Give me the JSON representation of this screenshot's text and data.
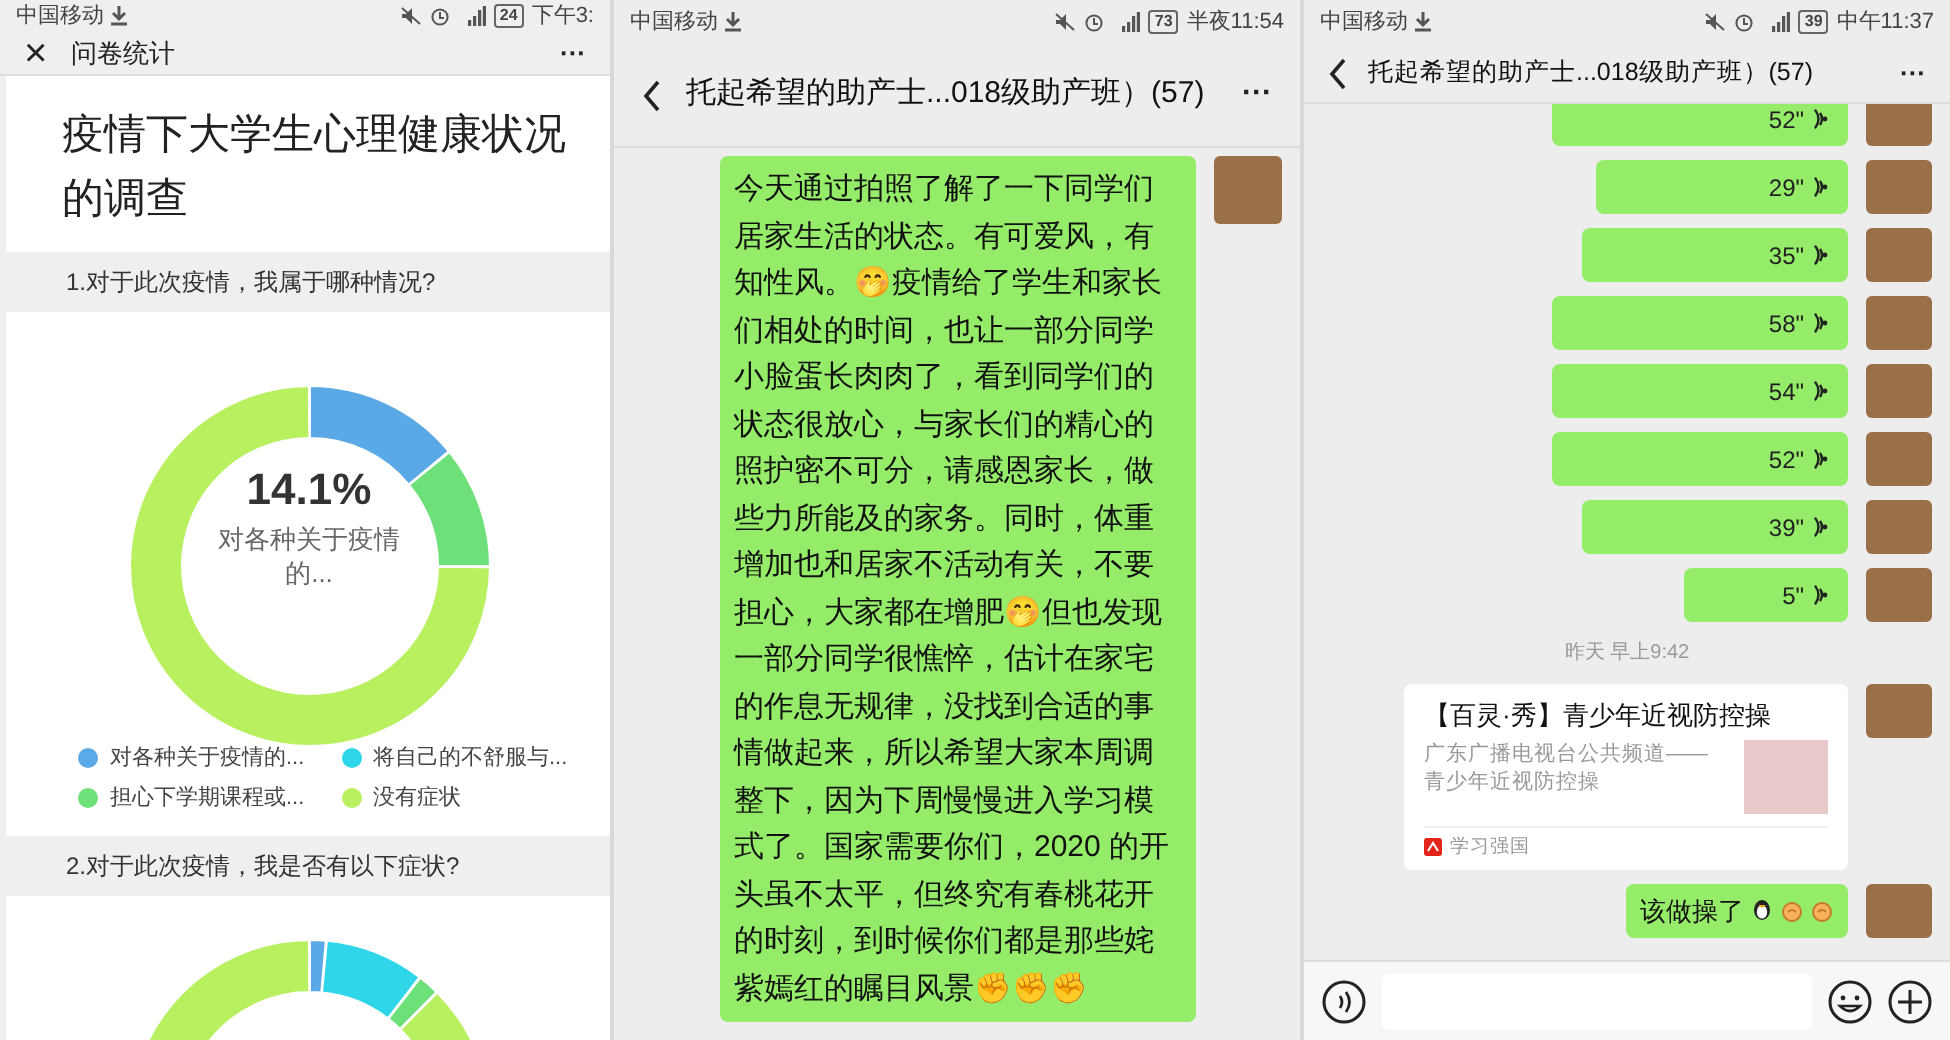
{
  "survey_screen": {
    "status_bar": {
      "carrier": "中国移动",
      "battery": "24",
      "time": "下午3:"
    },
    "nav": {
      "close": "×",
      "title": "问卷统计",
      "more": "···"
    },
    "title": "疫情下大学生心理健康状况的调查",
    "questions": [
      {
        "text": "1.对于此次疫情，我属于哪种情况?",
        "center_value": "14.1%",
        "center_label": "对各种关于疫情的...",
        "legend": [
          {
            "label": "对各种关于疫情的...",
            "color": "#5aa9e6"
          },
          {
            "label": "将自己的不舒服与...",
            "color": "#2fd6ea"
          },
          {
            "label": "担心下学期课程或...",
            "color": "#6ee07a"
          },
          {
            "label": "没有症状",
            "color": "#b8f060"
          }
        ]
      },
      {
        "text": "2.对于此次疫情，我是否有以下症状?"
      }
    ]
  },
  "group_chat_screen": {
    "status_bar": {
      "carrier": "中国移动",
      "battery": "73",
      "time": "半夜11:54"
    },
    "nav": {
      "title": "托起希望的助产士...018级助产班）(57)",
      "more": "···"
    },
    "message": "今天通过拍照了解了一下同学们居家生活的状态。有可爱风，有知性风。🤭疫情给了学生和家长们相处的时间，也让一部分同学小脸蛋长肉肉了，看到同学们的状态很放心，与家长们的精心的照护密不可分，请感恩家长，做些力所能及的家务。同时，体重增加也和居家不活动有关，不要担心，大家都在增肥🤭但也发现一部分同学很憔悴，估计在家宅的作息无规律，没找到合适的事情做起来，所以希望大家本周调整下，因为下周慢慢进入学习模式了。国家需要你们，2020 的开头虽不太平，但终究有春桃花开的时刻，到时候你们都是那些姹紫嫣红的瞩目风景✊✊✊"
  },
  "voice_chat_screen": {
    "status_bar": {
      "carrier": "中国移动",
      "battery": "39",
      "time": "中午11:37"
    },
    "nav": {
      "title": "托起希望的助产士...018级助产班）(57)",
      "more": "···"
    },
    "voice_messages": [
      "52\"",
      "29\"",
      "35\"",
      "58\"",
      "54\"",
      "52\"",
      "39\"",
      "5\""
    ],
    "timestamp": "昨天 早上9:42",
    "link_card": {
      "title": "【百灵·秀】青少年近视防控操",
      "description": "广东广播电视台公共频道——青少年近视防控操",
      "source": "学习强国"
    },
    "last_message": "该做操了"
  }
}
